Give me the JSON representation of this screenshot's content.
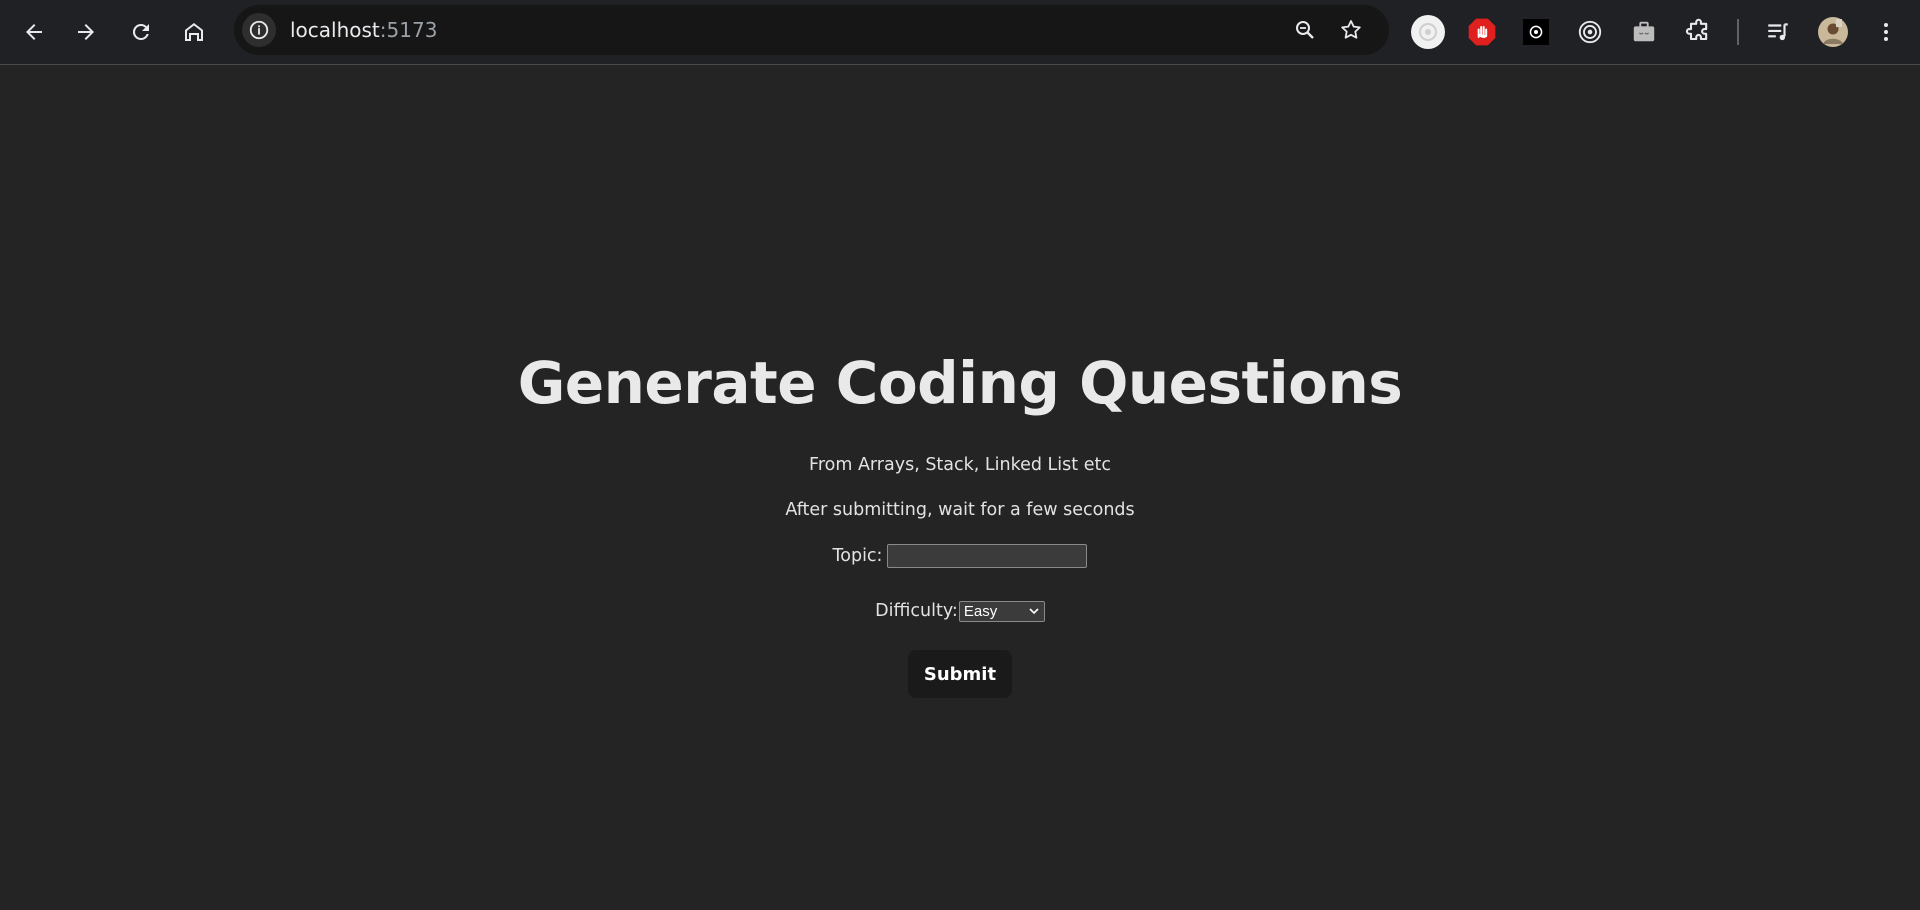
{
  "browser": {
    "url_host": "localhost",
    "url_port": ":5173",
    "icons": {
      "back": "arrow-left-icon",
      "forward": "arrow-right-icon",
      "reload": "reload-icon",
      "home": "home-icon",
      "site_info": "info-icon",
      "zoom": "zoom-icon",
      "bookmark": "star-icon"
    },
    "extensions": [
      "openai-icon",
      "adblock-icon",
      "chatgpt-icon",
      "target-icon",
      "briefcase-icon",
      "puzzle-icon",
      "media-queue-icon",
      "profile-avatar",
      "kebab-menu-icon"
    ]
  },
  "page": {
    "title": "Generate Coding Questions",
    "subtitle1": "From Arrays, Stack, Linked List etc",
    "subtitle2": "After submitting, wait for a few seconds",
    "topic_label": "Topic:",
    "topic_value": "",
    "difficulty_label": "Difficulty:",
    "difficulty_selected": "Easy",
    "submit_label": "Submit"
  },
  "colors": {
    "background": "#242424",
    "toolbar": "#202124",
    "button": "#1a1a1a"
  }
}
